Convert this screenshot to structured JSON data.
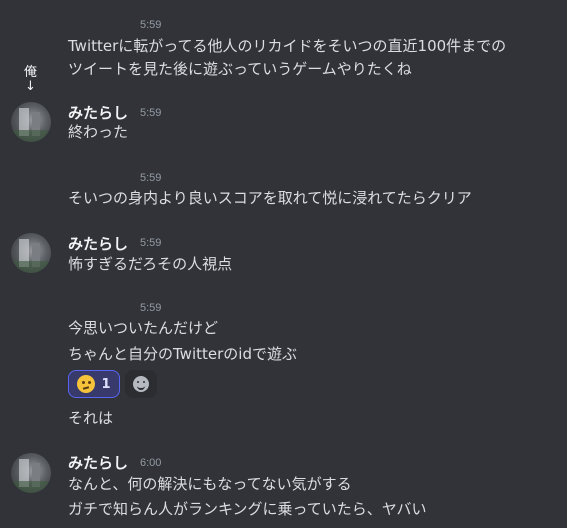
{
  "annotation": {
    "text": "俺",
    "arrow": "↓"
  },
  "messages": [
    {
      "time": "5:59",
      "lines": [
        "Twitterに転がってる他人のリカイドをそいつの直近100件までの",
        "ツイートを見た後に遊ぶっていうゲームやりたくね"
      ]
    },
    {
      "author": "みたらし",
      "time": "5:59",
      "lines": [
        "終わった"
      ]
    },
    {
      "time": "5:59",
      "lines": [
        "そいつの身内より良いスコアを取れて悦に浸れてたらクリア"
      ]
    },
    {
      "author": "みたらし",
      "time": "5:59",
      "lines": [
        "怖すぎるだろその人視点"
      ]
    },
    {
      "time": "5:59",
      "lines": [
        "今思いついたんだけど",
        "ちゃんと自分のTwitterのidで遊ぶ"
      ]
    },
    {
      "lines": [
        "それは"
      ]
    },
    {
      "author": "みたらし",
      "time": "6:00",
      "lines": [
        "なんと、何の解決にもなってない気がする",
        "ガチで知らん人がランキングに乗っていたら、ヤバい"
      ]
    }
  ],
  "reaction": {
    "emoji": "thinking-face",
    "count": "1"
  }
}
